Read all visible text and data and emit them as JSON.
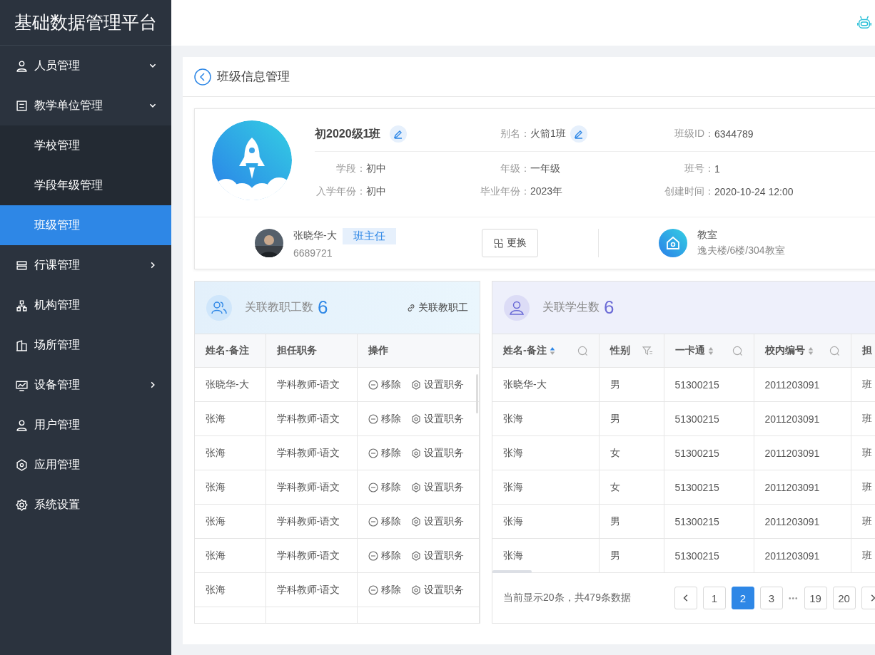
{
  "app_title": "基础数据管理平台",
  "sidebar": {
    "items": [
      {
        "label": "人员管理",
        "expanded": true
      },
      {
        "label": "教学单位管理",
        "expanded": true,
        "children": [
          {
            "label": "学校管理",
            "selected": false
          },
          {
            "label": "学段年级管理",
            "selected": false
          },
          {
            "label": "班级管理",
            "selected": true
          }
        ]
      },
      {
        "label": "行课管理",
        "expanded": false
      },
      {
        "label": "机构管理"
      },
      {
        "label": "场所管理"
      },
      {
        "label": "设备管理",
        "expanded": false
      },
      {
        "label": "用户管理"
      },
      {
        "label": "应用管理"
      },
      {
        "label": "系统设置"
      }
    ]
  },
  "page_title": "班级信息管理",
  "class_card": {
    "name": "初2020级1班",
    "alias_label": "别名：",
    "alias": "火箭1班",
    "id_label": "班级ID：",
    "id": "6344789",
    "fields": [
      {
        "label": "学段：",
        "value": "初中"
      },
      {
        "label": "年级：",
        "value": "一年级"
      },
      {
        "label": "班号：",
        "value": "1"
      },
      {
        "label": "入学年份：",
        "value": "初中"
      },
      {
        "label": "毕业年份：",
        "value": "2023年"
      },
      {
        "label": "创建时间：",
        "value": "2020-10-24  12:00"
      }
    ],
    "teacher": {
      "name": "张晓华-大",
      "badge": "班主任",
      "number": "6689721",
      "change_button": "更换"
    },
    "classroom": {
      "label": "教室",
      "location": "逸夫楼/6楼/304教室"
    }
  },
  "staff_panel": {
    "title": "关联教职工数",
    "count": "6",
    "link": "关联教职工",
    "columns": [
      "姓名-备注",
      "担任职务",
      "操作"
    ],
    "rows": [
      {
        "cells": [
          "张晓华-大",
          "学科教师-语文"
        ],
        "actions": [
          "移除",
          "设置职务"
        ]
      },
      {
        "cells": [
          "张海",
          "学科教师-语文"
        ],
        "actions": [
          "移除",
          "设置职务"
        ]
      },
      {
        "cells": [
          "张海",
          "学科教师-语文"
        ],
        "actions": [
          "移除",
          "设置职务"
        ]
      },
      {
        "cells": [
          "张海",
          "学科教师-语文"
        ],
        "actions": [
          "移除",
          "设置职务"
        ]
      },
      {
        "cells": [
          "张海",
          "学科教师-语文"
        ],
        "actions": [
          "移除",
          "设置职务"
        ]
      },
      {
        "cells": [
          "张海",
          "学科教师-语文"
        ],
        "actions": [
          "移除",
          "设置职务"
        ]
      },
      {
        "cells": [
          "张海",
          "学科教师-语文"
        ],
        "actions": [
          "移除",
          "设置职务"
        ]
      }
    ]
  },
  "student_panel": {
    "title": "关联学生数",
    "count": "6",
    "columns": [
      {
        "label": "姓名-备注",
        "sorted": true,
        "search": true
      },
      {
        "label": "性别",
        "filter": true
      },
      {
        "label": "一卡通",
        "sorted": false,
        "search": true
      },
      {
        "label": "校内编号",
        "sorted": false,
        "search": true
      },
      {
        "label": "担"
      }
    ],
    "rows": [
      [
        "张晓华-大",
        "男",
        "51300215",
        "2011203091",
        "班"
      ],
      [
        "张海",
        "男",
        "51300215",
        "2011203091",
        "班"
      ],
      [
        "张海",
        "女",
        "51300215",
        "2011203091",
        "班"
      ],
      [
        "张海",
        "女",
        "51300215",
        "2011203091",
        "班"
      ],
      [
        "张海",
        "男",
        "51300215",
        "2011203091",
        "班"
      ],
      [
        "张海",
        "男",
        "51300215",
        "2011203091",
        "班"
      ]
    ],
    "pagination": {
      "summary": "当前显示20条，共479条数据",
      "pages": [
        {
          "kind": "page",
          "label": "1",
          "selected": false
        },
        {
          "kind": "page",
          "label": "2",
          "selected": true
        },
        {
          "kind": "page",
          "label": "3",
          "selected": false
        },
        {
          "kind": "ellipsis",
          "label": "•••"
        },
        {
          "kind": "page",
          "label": "19",
          "selected": false
        },
        {
          "kind": "page",
          "label": "20",
          "selected": false
        }
      ]
    }
  }
}
